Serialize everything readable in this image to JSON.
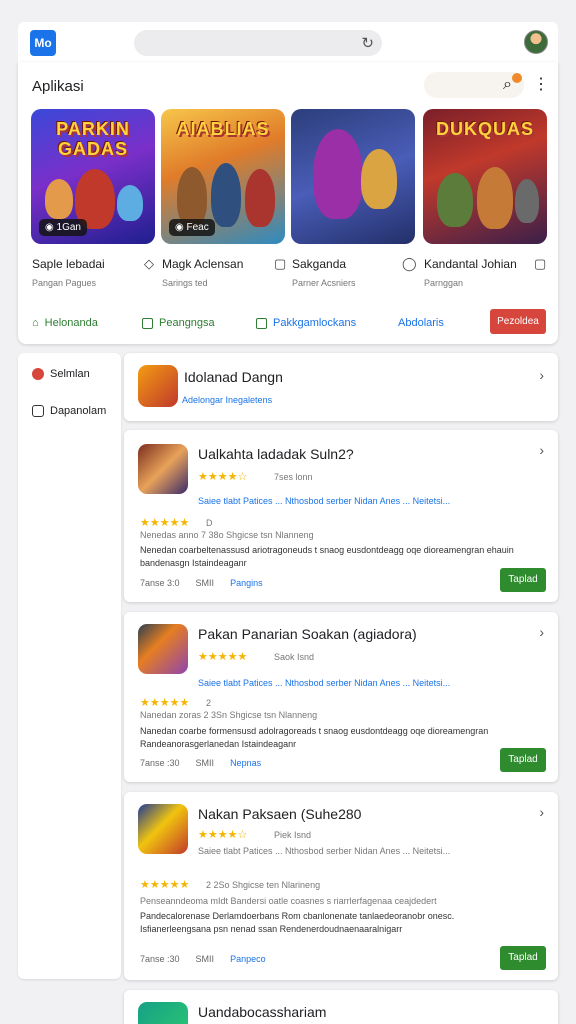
{
  "browser": {
    "logo": "Mo"
  },
  "featured": {
    "title": "Aplikasi",
    "games": [
      {
        "banner": "PARKIN GADAS",
        "chip": "◉ 1Gan",
        "title": "Saple lebadai",
        "sub": "Pangan Pagues"
      },
      {
        "banner": "AIABLIAS",
        "chip": "◉ Feac",
        "title": "Magk Aclensan",
        "sub": "Sarings ted"
      },
      {
        "banner": "",
        "chip": "",
        "title": "Sakganda",
        "sub": "Parner Acsniers"
      },
      {
        "banner": "DUKQUAS",
        "chip": "",
        "title": "Kandantal Johian",
        "sub": "Parnggan"
      }
    ],
    "filters": [
      "Helonanda",
      "Peangngsa",
      "Pakkgamlockans",
      "Abdolaris"
    ],
    "action": "Pezoldea"
  },
  "sidebar": {
    "items": [
      "Selmlan",
      "Dapanolam"
    ]
  },
  "suggestion": {
    "title": "Idolanad Dangn",
    "sub": "Adelongar Inegaletens"
  },
  "apps": [
    {
      "title": "Ualkahta ladadak Suln2?",
      "meta": "7ses lonn",
      "links": "Saiee tlabt Patices ... Nthosbod serber Nidan Anes ... Neitetsi...",
      "rating_row": "D",
      "info": "Nenedas anno 7 38o  Shgicse tsn  Nlanneng",
      "desc": "Nenedan coarbeltenassusd ariotragoneuds t snaog eusdontdeagg oqe dioreamengran ehauin bandenasgn Istaindeaganr",
      "foot1": "7anse 3:0",
      "foot2": "SMII",
      "foot3": "Pangins",
      "install": "Taplad"
    },
    {
      "title": "Pakan Panarian Soakan (agiadora)",
      "meta": "Saok Isnd",
      "links": "Saiee tlabt Patices ... Nthosbod serber Nidan Anes ... Neitetsi...",
      "rating_row": "2",
      "info": "Nanedan zoras 2 3Sn  Shgicse tsn  Nlanneng",
      "desc": "Nanedan coarbe formensusd adolragoreads t snaog eusdontdeagg oqe dioreamengran Randeanorasgerlanedan Istaindeaganr",
      "foot1": "7anse :30",
      "foot2": "SMII",
      "foot3": "Nepnas",
      "install": "Taplad"
    },
    {
      "title": "Nakan Paksaen (Suhe280",
      "meta": "Piek Isnd",
      "links": "Saiee tlabt Patices ... Nthosbod serber Nidan Anes ... Neitetsi...",
      "rating_row": "2 2So  Shgicse ten  Nlarineng",
      "info": "Penseanndeoma mIdt  Bandersi oatle coasnes s riarrlerfagenaa ceajdedert",
      "desc": "Pandecalorenase Derlamdoerbans  Rom cbanlonenate tanlaedeoranobr onesc. Isfianerleengsana psn nenad ssan Rendenerdoudnaenaaralnigarr",
      "foot1": "7anse :30",
      "foot2": "SMII",
      "foot3": "Panpeco",
      "install": "Taplad"
    }
  ],
  "last_app": {
    "title": "Uandabocasshariam"
  }
}
